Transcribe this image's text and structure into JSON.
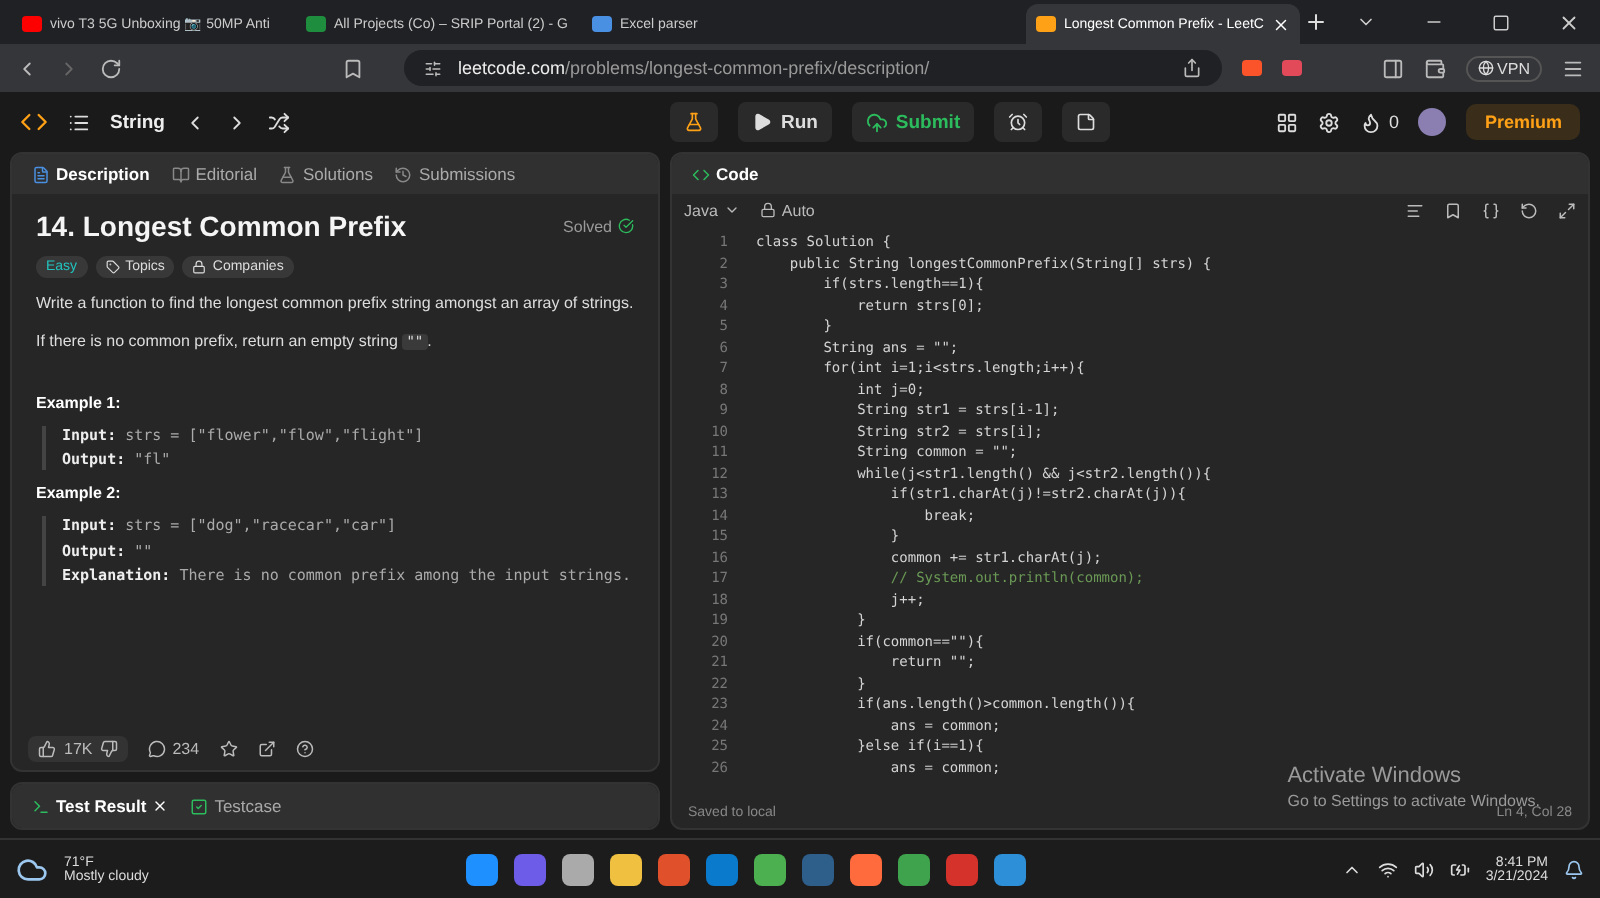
{
  "browser": {
    "tabs": [
      {
        "title": "vivo T3 5G Unboxing 📷 50MP Anti",
        "selected": false
      },
      {
        "title": "All Projects (Co) – SRIP Portal (2) - G",
        "selected": false
      },
      {
        "title": "Excel parser",
        "selected": false
      },
      {
        "title": "Longest Common Prefix - LeetC",
        "selected": true
      }
    ],
    "address": {
      "host": "leetcode.com",
      "path": "/problems/longest-common-prefix/description/"
    },
    "vpn": "VPN"
  },
  "header": {
    "list_title": "String",
    "run": "Run",
    "submit": "Submit",
    "streak": "0",
    "premium": "Premium"
  },
  "description_panel": {
    "tabs": [
      {
        "label": "Description",
        "selected": true
      },
      {
        "label": "Editorial",
        "selected": false
      },
      {
        "label": "Solutions",
        "selected": false
      },
      {
        "label": "Submissions",
        "selected": false
      }
    ],
    "title": "14. Longest Common Prefix",
    "status": "Solved",
    "tags": [
      {
        "label": "Easy",
        "kind": "difficulty"
      },
      {
        "label": "Topics",
        "kind": "topics"
      },
      {
        "label": "Companies",
        "kind": "companies"
      }
    ],
    "paragraphs": [
      {
        "before": "Write a function to find the longest common prefix string amongst an array of strings."
      },
      {
        "before": "If there is no common prefix, return an empty string ",
        "code": "\"\"",
        "after": "."
      }
    ],
    "examples": [
      {
        "title": "Example 1:",
        "lines": [
          {
            "label": "Input:",
            "value": "strs = [\"flower\",\"flow\",\"flight\"]"
          },
          {
            "label": "Output:",
            "value": "\"fl\""
          }
        ]
      },
      {
        "title": "Example 2:",
        "lines": [
          {
            "label": "Input:",
            "value": "strs = [\"dog\",\"racecar\",\"car\"]"
          },
          {
            "label": "Output:",
            "value": "\"\""
          },
          {
            "label": "Explanation:",
            "value": "There is no common prefix among the input strings."
          }
        ]
      }
    ],
    "likes": "17K",
    "comments": "234"
  },
  "console_panel": {
    "tabs": [
      {
        "label": "Test Result",
        "selected": true
      },
      {
        "label": "Testcase",
        "selected": false
      }
    ]
  },
  "code_panel": {
    "title": "Code",
    "language": "Java",
    "mode": "Auto",
    "lines": [
      {
        "number": "1",
        "text": "class Solution {",
        "kind": "code"
      },
      {
        "number": "2",
        "text": "    public String longestCommonPrefix(String[] strs) {",
        "kind": "code"
      },
      {
        "number": "3",
        "text": "        if(strs.length==1){",
        "kind": "code"
      },
      {
        "number": "4",
        "text": "            return strs[0];",
        "kind": "code"
      },
      {
        "number": "5",
        "text": "        }",
        "kind": "code"
      },
      {
        "number": "6",
        "text": "        String ans = \"\";",
        "kind": "code"
      },
      {
        "number": "7",
        "text": "        for(int i=1;i<strs.length;i++){",
        "kind": "code"
      },
      {
        "number": "8",
        "text": "            int j=0;",
        "kind": "code"
      },
      {
        "number": "9",
        "text": "            String str1 = strs[i-1];",
        "kind": "code"
      },
      {
        "number": "10",
        "text": "            String str2 = strs[i];",
        "kind": "code"
      },
      {
        "number": "11",
        "text": "            String common = \"\";",
        "kind": "code"
      },
      {
        "number": "12",
        "text": "            while(j<str1.length() && j<str2.length()){",
        "kind": "code"
      },
      {
        "number": "13",
        "text": "                if(str1.charAt(j)!=str2.charAt(j)){",
        "kind": "code"
      },
      {
        "number": "14",
        "text": "                    break;",
        "kind": "code"
      },
      {
        "number": "15",
        "text": "                }",
        "kind": "code"
      },
      {
        "number": "16",
        "text": "                common += str1.charAt(j);",
        "kind": "code"
      },
      {
        "number": "17",
        "text": "                // System.out.println(common);",
        "kind": "comment"
      },
      {
        "number": "18",
        "text": "                j++;",
        "kind": "code"
      },
      {
        "number": "19",
        "text": "            }",
        "kind": "code"
      },
      {
        "number": "20",
        "text": "            if(common==\"\"){",
        "kind": "code"
      },
      {
        "number": "21",
        "text": "                return \"\";",
        "kind": "code"
      },
      {
        "number": "22",
        "text": "            }",
        "kind": "code"
      },
      {
        "number": "23",
        "text": "            if(ans.length()>common.length()){",
        "kind": "code"
      },
      {
        "number": "24",
        "text": "                ans = common;",
        "kind": "code"
      },
      {
        "number": "25",
        "text": "            }else if(i==1){",
        "kind": "code"
      },
      {
        "number": "26",
        "text": "                ans = common;",
        "kind": "code"
      }
    ],
    "saved": "Saved to local",
    "position": "Ln 4, Col 28"
  },
  "activation": {
    "title": "Activate Windows",
    "subtitle": "Go to Settings to activate Windows."
  },
  "taskbar": {
    "temperature": "71°F",
    "weather": "Mostly cloudy",
    "time": "8:41 PM",
    "date": "3/21/2024"
  }
}
